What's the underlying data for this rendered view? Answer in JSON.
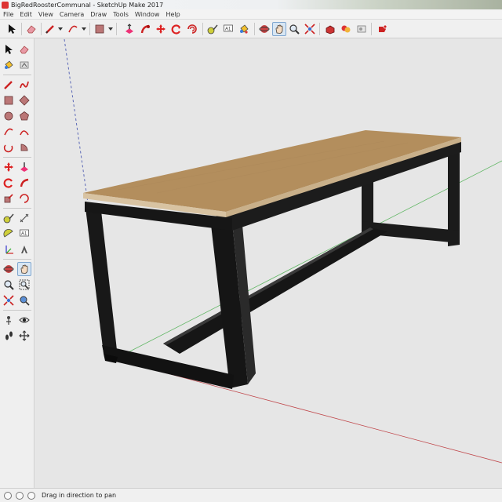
{
  "window": {
    "title": "BigRedRoosterCommunal - SketchUp Make 2017"
  },
  "menu": [
    "File",
    "Edit",
    "View",
    "Camera",
    "Draw",
    "Tools",
    "Window",
    "Help"
  ],
  "top_toolbar": {
    "icons": [
      "select-icon",
      "eraser-icon",
      "pencil-line-icon",
      "arc-icon",
      "rectangle-icon",
      "push-pull-icon",
      "move-icon",
      "rotate-icon",
      "follow-me-icon",
      "tape-measure-icon",
      "text-icon",
      "paint-bucket-icon",
      "orbit-icon",
      "pan-icon",
      "zoom-icon",
      "zoom-extents-icon",
      "3d-warehouse-icon",
      "extension-warehouse-icon",
      "layout-icon",
      "extension-manager-icon"
    ],
    "active": "pan-icon"
  },
  "left_toolbar": {
    "icons": [
      "select-icon",
      "eraser-icon",
      "line-icon",
      "freehand-icon",
      "rectangle-icon",
      "rotated-rectangle-icon",
      "circle-icon",
      "polygon-icon",
      "arc-icon",
      "two-point-arc-icon",
      "three-point-arc-icon",
      "pie-icon",
      "move-icon",
      "push-pull-icon",
      "rotate-icon",
      "follow-me-icon",
      "scale-icon",
      "offset-icon",
      "tape-measure-icon",
      "dimension-icon",
      "protractor-icon",
      "text-icon",
      "axes-icon",
      "3d-text-icon",
      "orbit-icon",
      "pan-icon",
      "zoom-icon",
      "zoom-window-icon",
      "zoom-extents-icon",
      "previous-view-icon",
      "position-camera-icon",
      "look-around-icon",
      "walk-icon",
      "section-plane-icon"
    ],
    "active": "pan-icon"
  },
  "status": {
    "message": "Drag in direction to pan"
  },
  "colors": {
    "tabletop": "#b38e5d",
    "tabletop_edge": "#d8c3a2",
    "frame": "#1b1b1b",
    "axis_red": "#c0474b",
    "axis_green": "#4caf50",
    "axis_blue": "#3949ab",
    "accent_active": "#7fa6cf"
  }
}
